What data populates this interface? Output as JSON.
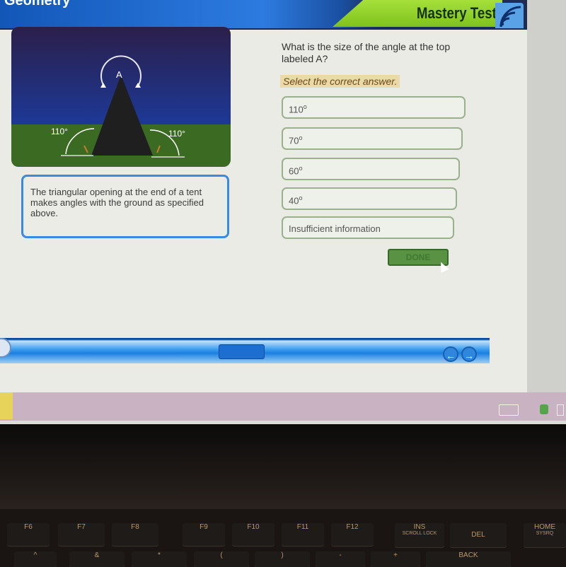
{
  "app": {
    "title": "Geometry",
    "mode_label": "Mastery Test"
  },
  "figure": {
    "vertex_label": "A",
    "left_angle": "110°",
    "right_angle": "110°"
  },
  "prompt": {
    "text": "The triangular opening at the end of a tent makes angles with the ground as specified above."
  },
  "question": {
    "text": "What is the size of the angle at the top labeled A?",
    "instruction": "Select the correct answer.",
    "options": [
      {
        "value": "110",
        "unit": "o"
      },
      {
        "value": "70",
        "unit": "o"
      },
      {
        "value": "60",
        "unit": "o"
      },
      {
        "value": "40",
        "unit": "o"
      },
      {
        "value": "Insufficient information",
        "unit": ""
      }
    ],
    "done_label": "DONE"
  },
  "navbar": {
    "prev_icon": "←",
    "next_icon": "→"
  },
  "keyboard": {
    "keys": [
      "F6",
      "F7",
      "F8",
      "F9",
      "F10",
      "F11",
      "F12",
      "INS",
      "DEL",
      "HOME"
    ],
    "key_sublabels": [
      "",
      "",
      "",
      "",
      "",
      "",
      "",
      "SCROLL LOCK",
      "",
      "SYSRQ"
    ],
    "row2": [
      "^",
      "&",
      "*",
      "(",
      ")",
      "-",
      "+",
      "BACK"
    ]
  },
  "colors": {
    "accent_blue": "#3a8ae0",
    "mastery_green": "#8fd12a",
    "done_green": "#5a9244"
  }
}
